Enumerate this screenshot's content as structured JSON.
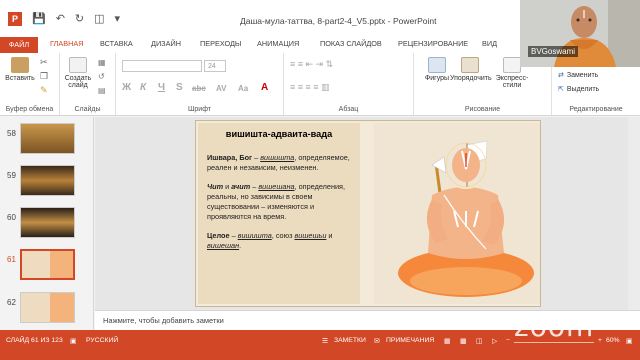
{
  "window": {
    "title": "Даша-мула-таттва, 8-part2-4_V5.pptx - PowerPoint"
  },
  "ribbon_tabs": [
    "ФАЙЛ",
    "ГЛАВНАЯ",
    "ВСТАВКА",
    "ДИЗАЙН",
    "ПЕРЕХОДЫ",
    "АНИМАЦИЯ",
    "ПОКАЗ СЛАЙДОВ",
    "РЕЦЕНЗИРОВАНИЕ",
    "ВИД"
  ],
  "ribbon": {
    "paste": "Вставить",
    "new_slide_line1": "Создать",
    "new_slide_line2": "слайд",
    "clipboard_group": "Буфер обмена",
    "slides_group": "Слайды",
    "font_group": "Шрифт",
    "paragraph_group": "Абзац",
    "drawing_group": "Рисование",
    "shapes": "Фигуры",
    "arrange": "Упорядочить",
    "quick_styles_line1": "Экспресс-",
    "quick_styles_line2": "стили",
    "font_size": "24",
    "format_buttons": [
      "Ж",
      "К",
      "Ч",
      "S",
      "abc",
      "AV",
      "Aa"
    ],
    "editing": {
      "replace": "Заменить",
      "select": "Выделить",
      "group": "Редактирование"
    }
  },
  "thumbnails": [
    {
      "num": "58",
      "color": "#a77a3c"
    },
    {
      "num": "59",
      "color": "#7a5a2a"
    },
    {
      "num": "60",
      "color": "#8c6a34"
    },
    {
      "num": "61",
      "color": "#f1dcc2"
    },
    {
      "num": "62",
      "color": "#f1dcc2"
    }
  ],
  "slide": {
    "title": "вишишта-адваита-вада",
    "p1_bold": "Ишвара, Бог",
    "p1_dash": " – ",
    "p1_term": "вишишта",
    "p1_rest": ", определяемое, реален и независим, неизменен.",
    "p2_bold": "Чит",
    "p2_and": " и ",
    "p2_bold2": "ачит",
    "p2_dash": " – ",
    "p2_term": "вишешана",
    "p2_rest": ", определения, реальны, но зависимы в своем существовании – изменяются и проявляются на время.",
    "p3_bold": "Целое",
    "p3_dash": " – ",
    "p3_term": "вишишта",
    "p3_mid": ", союз ",
    "p3_term2": "вишешьи",
    "p3_and": " и ",
    "p3_term3": "вишешан",
    "p3_end": "."
  },
  "notes_placeholder": "Нажмите, чтобы добавить заметки",
  "statusbar": {
    "slide_info": "СЛАЙД 61 ИЗ 123",
    "language": "РУССКИЙ",
    "notes": "ЗАМЕТКИ",
    "comments": "ПРИМЕЧАНИЯ",
    "zoom": "60%"
  },
  "webcam": {
    "name": "BVGoswami"
  },
  "watermark": "zoom"
}
